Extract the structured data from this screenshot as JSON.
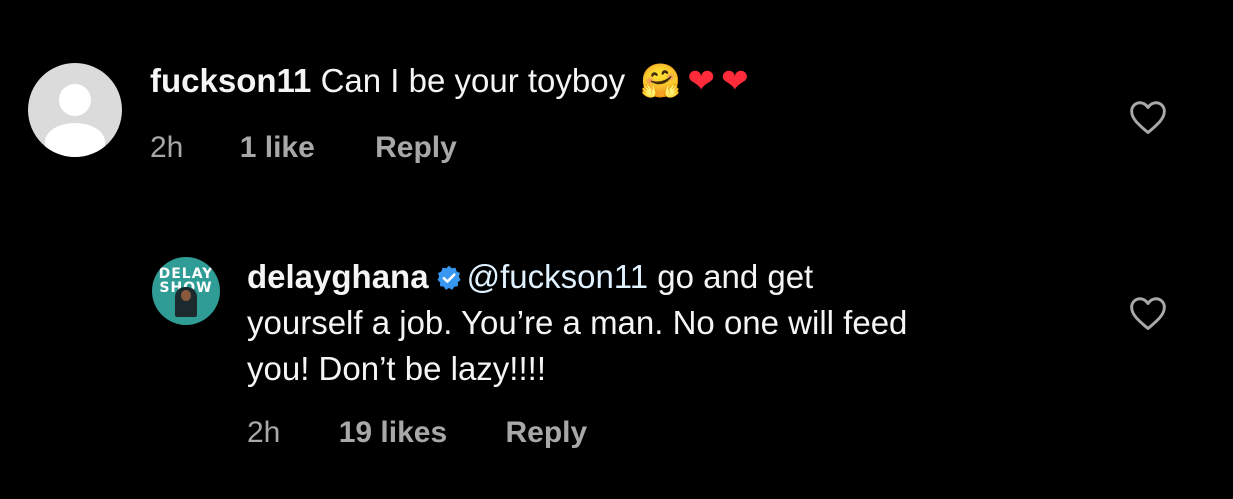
{
  "comments": [
    {
      "username": "fuckson11",
      "text": "Can I be your toyboy",
      "emojis": [
        "🤗",
        "❤",
        "❤"
      ],
      "time": "2h",
      "likes": "1 like",
      "reply_label": "Reply",
      "avatar_icon": "default-user-avatar"
    },
    {
      "username": "delayghana",
      "verified": true,
      "avatar_text": "DELAY\nSHOW",
      "mention": "@fuckson11",
      "text_line1": "go and get",
      "text_line2": "yourself a job. You’re a man. No one will feed",
      "text_line3": "you! Don’t be lazy!!!!",
      "time": "2h",
      "likes": "19 likes",
      "reply_label": "Reply"
    }
  ],
  "colors": {
    "background": "#000000",
    "text": "#f5f5f5",
    "muted": "#a8a8a8",
    "verified": "#3897f0",
    "heart_emoji": "#ff2b3b"
  }
}
